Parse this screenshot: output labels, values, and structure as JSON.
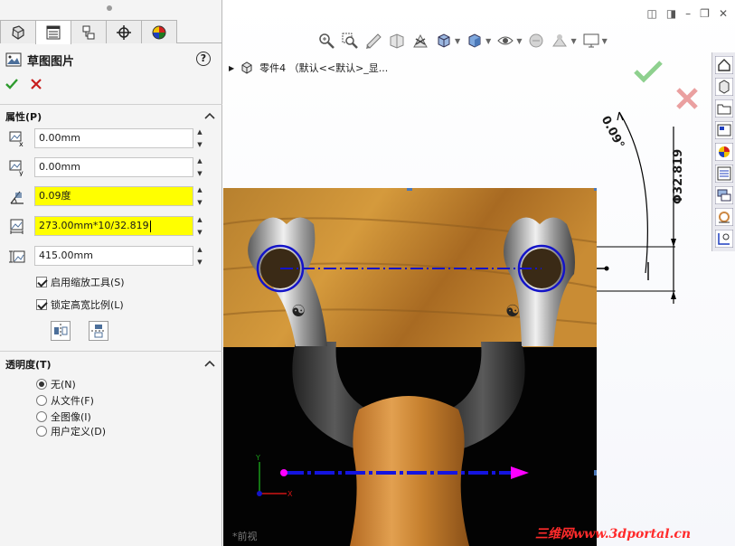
{
  "panel": {
    "title": "草图图片",
    "help": "?",
    "properties_header": "属性(P)",
    "fields": [
      {
        "name": "x-position",
        "value": "0.00mm"
      },
      {
        "name": "y-position",
        "value": "0.00mm"
      },
      {
        "name": "angle",
        "value": "0.09度"
      },
      {
        "name": "width",
        "value": "273.00mm*10/32.819"
      },
      {
        "name": "height",
        "value": "415.00mm"
      }
    ],
    "enable_scale_tool": "启用缩放工具(S)",
    "lock_aspect_ratio": "锁定高宽比例(L)",
    "transparency_header": "透明度(T)",
    "radio_none": "无(N)",
    "radio_from_file": "从文件(F)",
    "radio_full_image": "全图像(I)",
    "radio_user_defined": "用户定义(D)"
  },
  "graphics": {
    "tree_label": "零件4 （默认<<默认>_显...",
    "dim_angle": "0.09°",
    "dim_diameter": "Φ32.819",
    "preview_label": "*前视",
    "watermark": "三维网www.3dportal.cn"
  },
  "colors": {
    "field_highlight": "#ffff00",
    "ok_green": "#2e9b2e",
    "cancel_red": "#c81e1e",
    "sketch_blue": "#1414c8",
    "axis_magenta": "#ff00ff",
    "dimension_black": "#000000"
  }
}
